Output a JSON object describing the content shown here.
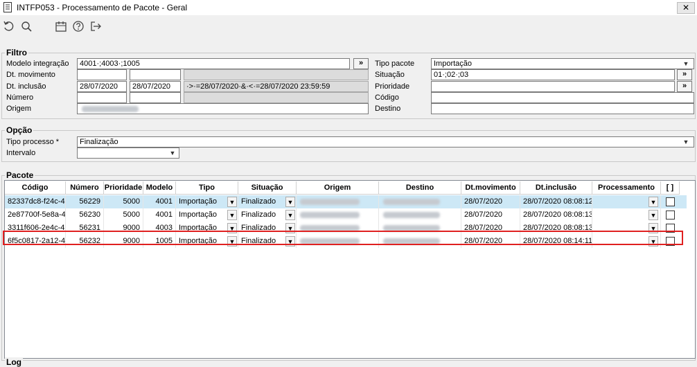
{
  "window": {
    "title": "INTFP053 - Processamento de Pacote - Geral",
    "close_label": "✕"
  },
  "toolbar": {
    "icons": [
      "refresh-icon",
      "search-icon",
      "calendar-icon",
      "help-icon",
      "exit-icon"
    ]
  },
  "filtro": {
    "legend": "Filtro",
    "modelo_label": "Modelo integração",
    "modelo_value": "4001·;4003·;1005",
    "dt_movimento_label": "Dt. movimento",
    "dt_inclusao_label": "Dt. inclusão",
    "dt_inclusao_from": "28/07/2020",
    "dt_inclusao_to": "28/07/2020",
    "dt_inclusao_expr": "·>·=28/07/2020·&·<·=28/07/2020 23:59:59",
    "numero_label": "Número",
    "origem_label": "Origem",
    "tipo_pacote_label": "Tipo pacote",
    "tipo_pacote_value": "Importação",
    "situacao_label": "Situação",
    "situacao_value": "01·;02·;03",
    "prioridade_label": "Prioridade",
    "codigo_label": "Código",
    "destino_label": "Destino",
    "more_btn": "»"
  },
  "opcao": {
    "legend": "Opção",
    "tipo_processo_label": "Tipo processo *",
    "tipo_processo_value": "Finalização",
    "intervalo_label": "Intervalo"
  },
  "pacote": {
    "legend": "Pacote",
    "columns": [
      "Código",
      "Número",
      "Prioridade",
      "Modelo",
      "Tipo",
      "Situação",
      "Origem",
      "Destino",
      "Dt.movimento",
      "Dt.inclusão",
      "Processamento",
      "[ ]"
    ],
    "rows": [
      {
        "codigo": "82337dc8-f24c-4",
        "numero": "56229",
        "prioridade": "5000",
        "modelo": "4001",
        "tipo": "Importação",
        "situacao": "Finalizado",
        "dt_movimento": "28/07/2020",
        "dt_inclusao": "28/07/2020 08:08:12",
        "selected": true,
        "checked": false
      },
      {
        "codigo": "2e87700f-5e8a-4",
        "numero": "56230",
        "prioridade": "5000",
        "modelo": "4001",
        "tipo": "Importação",
        "situacao": "Finalizado",
        "dt_movimento": "28/07/2020",
        "dt_inclusao": "28/07/2020 08:08:13",
        "selected": false,
        "checked": false
      },
      {
        "codigo": "3311f606-2e4c-4",
        "numero": "56231",
        "prioridade": "9000",
        "modelo": "4003",
        "tipo": "Importação",
        "situacao": "Finalizado",
        "dt_movimento": "28/07/2020",
        "dt_inclusao": "28/07/2020 08:08:13",
        "selected": false,
        "checked": false
      },
      {
        "codigo": "6f5c0817-2a12-4",
        "numero": "56232",
        "prioridade": "9000",
        "modelo": "1005",
        "tipo": "Importação",
        "situacao": "Finalizado",
        "dt_movimento": "28/07/2020",
        "dt_inclusao": "28/07/2020 08:14:11",
        "selected": false,
        "checked": false
      }
    ]
  },
  "log": {
    "legend": "Log"
  }
}
